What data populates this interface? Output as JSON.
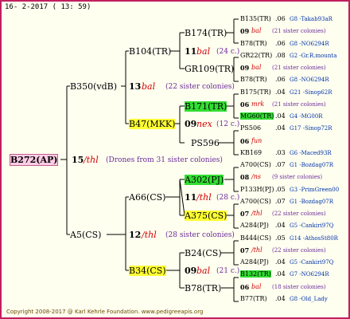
{
  "header": "16- 2-2017 ( 13: 59)",
  "footer": "Copyright 2008-2017 @ Karl Kehrle Foundation.   www.pedigreeapis.org",
  "root": {
    "id": "B272(AP)",
    "num": "15",
    "mark": "/thl",
    "note": "(Drones from 31 sister colonies)"
  },
  "g1": [
    {
      "id": "B350(vdB)",
      "num": "13",
      "mark": "bal",
      "note": "(22 sister colonies)"
    },
    {
      "id": "A5(CS)",
      "num": "12",
      "mark": "/thl",
      "note": "(28 sister colonies)"
    }
  ],
  "g2": [
    {
      "id": "B104(TR)",
      "num": "11",
      "mark": "bal",
      "note": "(24 c.)"
    },
    {
      "id": "B47(MKK)",
      "num": "09",
      "mark": "nex",
      "note": "(12 c.)"
    },
    {
      "id": "A66(CS)",
      "num": "11",
      "mark": "/thl",
      "note": "(28 c.)"
    },
    {
      "id": "B34(CS)",
      "num": "09",
      "mark": "bal",
      "note": "(21 c.)"
    }
  ],
  "g3": [
    {
      "id": "B174(TR)"
    },
    {
      "id": "GR109(TR)"
    },
    {
      "id": "B171(TR)"
    },
    {
      "id": "PS596"
    },
    {
      "id": "A302(PJ)"
    },
    {
      "id": "A375(CS)"
    },
    {
      "id": "B24(CS)"
    },
    {
      "id": "B78(TR)"
    }
  ],
  "g4": [
    {
      "id": "B135(TR)",
      "yr": ".06",
      "ref": "G8 -Takab93aR"
    },
    {
      "num": "09",
      "mark": "bal",
      "note": "(21 sister colonies)"
    },
    {
      "id": "B78(TR)",
      "yr": ".06",
      "ref": "G8 -NO6294R"
    },
    {
      "id": "GR22(TR)",
      "yr": ".08",
      "ref": "G2 -Gr.R.mounta"
    },
    {
      "num": "09",
      "mark": "bal",
      "note": "(21 sister colonies)"
    },
    {
      "id": "B78(TR)",
      "yr": ".06",
      "ref": "G8 -NO6294R"
    },
    {
      "id": "B175(TR)",
      "yr": ".04",
      "ref": "G21 -Sinop62R"
    },
    {
      "num": "06",
      "mark": "mrk",
      "note": "(21 sister colonies)"
    },
    {
      "id": "MG60(TR)",
      "yr": ".04",
      "ref": "G4 -MG00R"
    },
    {
      "id": "PS506",
      "yr": ".04",
      "ref": "G17 -Sinop72R"
    },
    {
      "num": "06",
      "mark": "fun",
      "note": ""
    },
    {
      "id": "KB169",
      "yr": ".03",
      "ref": "G6 -Maced93R"
    },
    {
      "id": "A700(CS)",
      "yr": ".07",
      "ref": "G1 -Bozdag07R"
    },
    {
      "num": "08",
      "mark": "/ns",
      "note": "(9 sister colonies)"
    },
    {
      "id": "P133H(PJ)",
      "yr": ".05",
      "ref": "G3 -PrimGreen00"
    },
    {
      "id": "A700(CS)",
      "yr": ".07",
      "ref": "G1 -Bozdag07R"
    },
    {
      "num": "07",
      "mark": "/thl",
      "note": "(22 sister colonies)"
    },
    {
      "id": "A284(PJ)",
      "yr": ".04",
      "ref": "G5 -Cankiri97Q"
    },
    {
      "id": "B444(CS)",
      "yr": ".05",
      "ref": "G14 -AthosSt80R"
    },
    {
      "num": "07",
      "mark": "/thl",
      "note": "(22 sister colonies)"
    },
    {
      "id": "A284(PJ)",
      "yr": ".04",
      "ref": "G5 -Cankiri97Q"
    },
    {
      "id": "B132(TR)",
      "yr": ".04",
      "ref": "G7 -NO6294R"
    },
    {
      "num": "06",
      "mark": "bal",
      "note": "(18 sister colonies)"
    },
    {
      "id": "B77(TR)",
      "yr": ".04",
      "ref": "G8 -Old_Lady"
    }
  ]
}
